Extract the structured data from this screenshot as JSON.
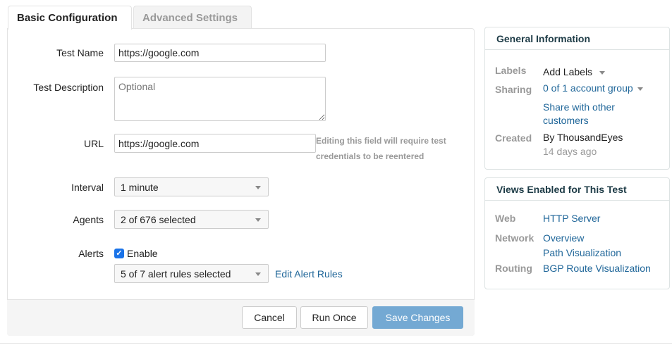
{
  "tabs": {
    "basic": "Basic Configuration",
    "advanced": "Advanced Settings"
  },
  "form": {
    "test_name_label": "Test Name",
    "test_name_value": "https://google.com",
    "description_label": "Test Description",
    "description_placeholder": "Optional",
    "url_label": "URL",
    "url_value": "https://google.com",
    "url_hint_1": "Editing this field will require test",
    "url_hint_2": "credentials to be reentered",
    "interval_label": "Interval",
    "interval_value": "1 minute",
    "agents_label": "Agents",
    "agents_value": "2 of 676 selected",
    "alerts_label": "Alerts",
    "alerts_enable": "Enable",
    "alerts_enabled": true,
    "alert_rules_value": "5 of 7 alert rules selected",
    "edit_alert_rules": "Edit Alert Rules"
  },
  "buttons": {
    "cancel": "Cancel",
    "run_once": "Run Once",
    "save": "Save Changes"
  },
  "general": {
    "title": "General Information",
    "labels_key": "Labels",
    "labels_value": "Add Labels",
    "sharing_key": "Sharing",
    "sharing_value": "0 of 1 account group",
    "share_other_1": "Share with other",
    "share_other_2": "customers",
    "created_key": "Created",
    "created_by": "By ThousandEyes",
    "created_ago": "14 days ago"
  },
  "views": {
    "title": "Views Enabled for This Test",
    "web_key": "Web",
    "web_1": "HTTP Server",
    "network_key": "Network",
    "network_1": "Overview",
    "network_2": "Path Visualization",
    "routing_key": "Routing",
    "routing_1": "BGP Route Visualization"
  },
  "colors": {
    "link": "#1f6699",
    "save_button": "#74a9d3",
    "checkbox": "#1a73e8"
  }
}
